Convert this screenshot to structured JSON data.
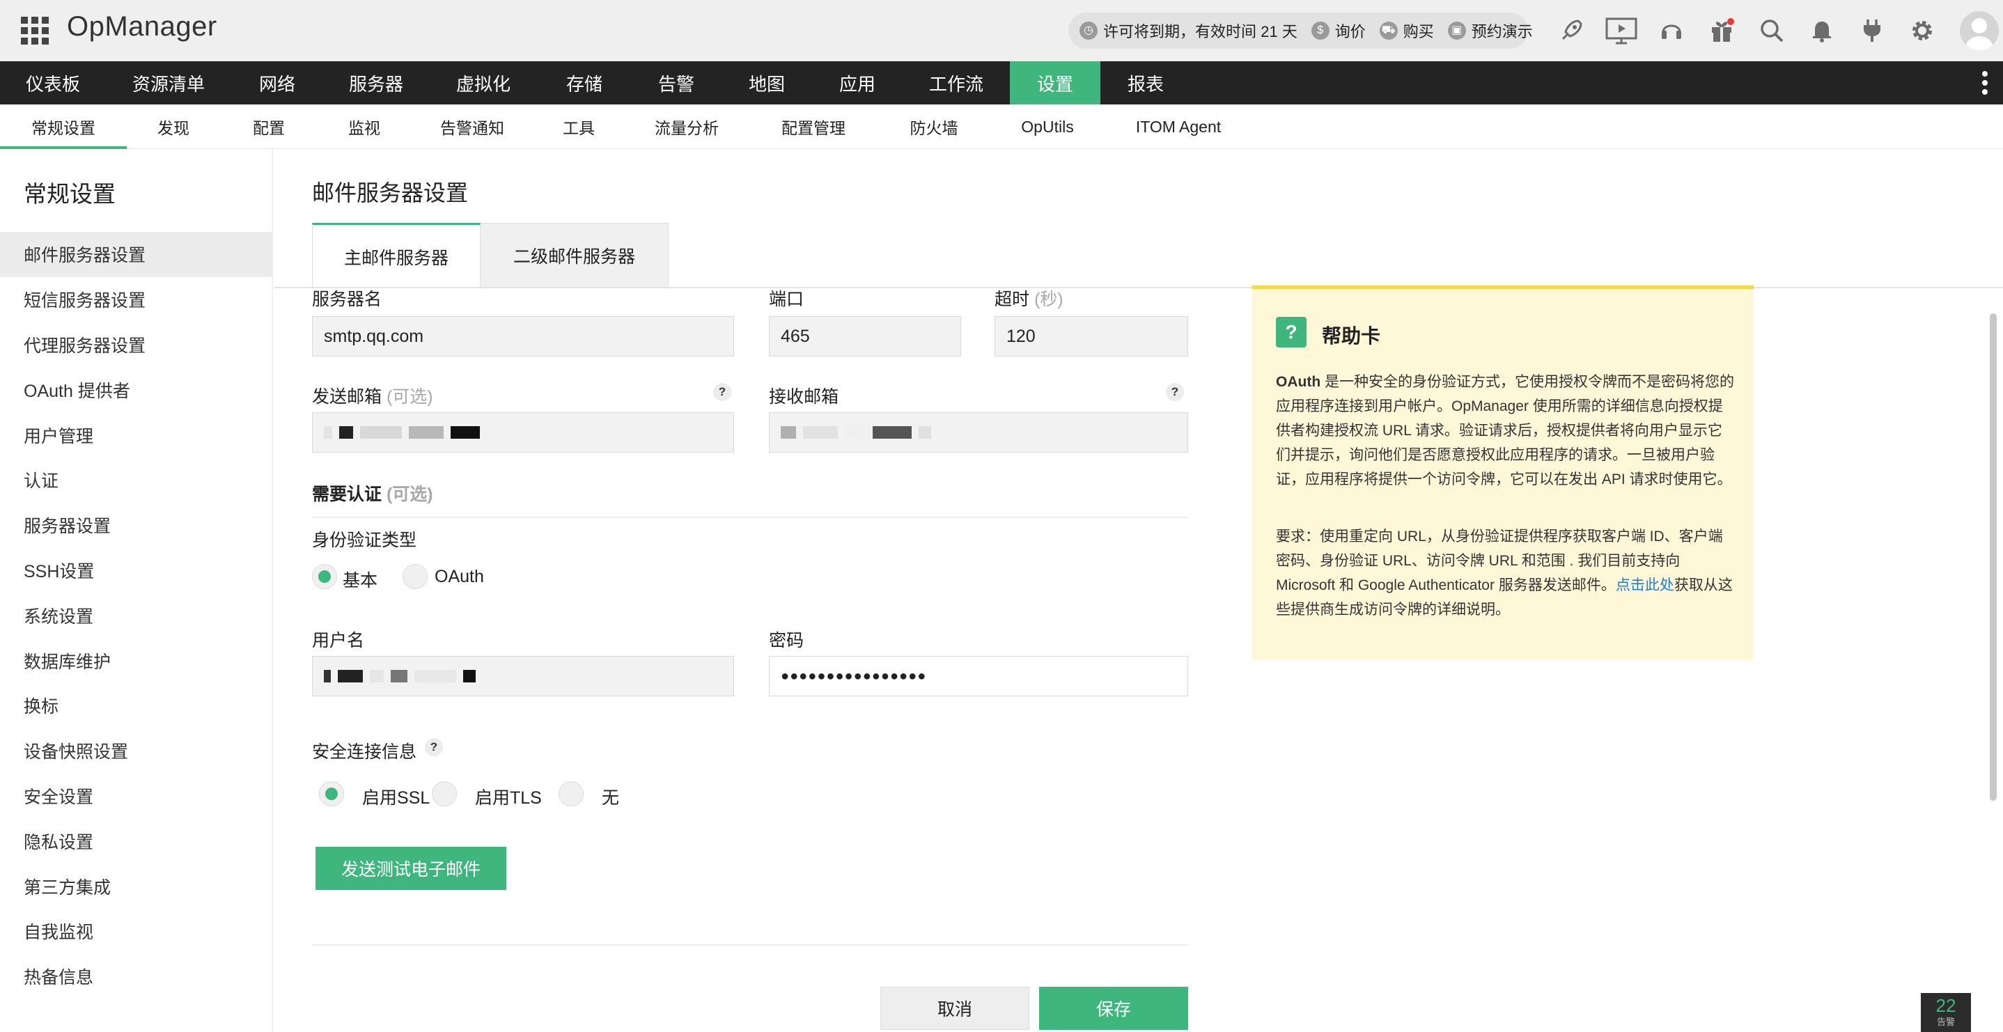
{
  "app": {
    "title": "OpManager"
  },
  "header": {
    "license_text": "许可将到期，有效时间 21 天",
    "quote_label": "询价",
    "buy_label": "购买",
    "demo_label": "预约演示",
    "icons": [
      "rocket-icon",
      "presentation-icon",
      "headset-icon",
      "gift-icon",
      "search-icon",
      "bell-icon",
      "plug-icon",
      "gear-icon",
      "user-avatar-icon"
    ]
  },
  "main_nav": {
    "items": [
      "仪表板",
      "资源清单",
      "网络",
      "服务器",
      "虚拟化",
      "存储",
      "告警",
      "地图",
      "应用",
      "工作流",
      "设置",
      "报表"
    ],
    "active_index": 10
  },
  "sub_nav": {
    "items": [
      "常规设置",
      "发现",
      "配置",
      "监视",
      "告警通知",
      "工具",
      "流量分析",
      "配置管理",
      "防火墙",
      "OpUtils",
      "ITOM Agent"
    ],
    "active_index": 0
  },
  "sidebar": {
    "title": "常规设置",
    "items": [
      "邮件服务器设置",
      "短信服务器设置",
      "代理服务器设置",
      "OAuth 提供者",
      "用户管理",
      "认证",
      "服务器设置",
      "SSH设置",
      "系统设置",
      "数据库维护",
      "换标",
      "设备快照设置",
      "安全设置",
      "隐私设置",
      "第三方集成",
      "自我监视",
      "热备信息"
    ],
    "active_index": 0
  },
  "page": {
    "title": "邮件服务器设置",
    "tabs": [
      "主邮件服务器",
      "二级邮件服务器"
    ],
    "active_tab": 0
  },
  "form": {
    "server_name_label": "服务器名",
    "server_name_value": "smtp.qq.com",
    "port_label": "端口",
    "port_value": "465",
    "timeout_label": "超时",
    "timeout_unit": "(秒)",
    "timeout_value": "120",
    "from_label": "发送邮箱",
    "from_optional": "(可选)",
    "to_label": "接收邮箱",
    "auth_label": "需要认证",
    "auth_optional": "(可选)",
    "auth_type_label": "身份验证类型",
    "auth_basic": "基本",
    "auth_oauth": "OAuth",
    "username_label": "用户名",
    "password_label": "密码",
    "password_value": "●●●●●●●●●●●●●●●●",
    "security_label": "安全连接信息",
    "ssl_label": "启用SSL",
    "tls_label": "启用TLS",
    "none_label": "无",
    "help_mark": "?",
    "test_button": "发送测试电子邮件",
    "cancel_button": "取消",
    "save_button": "保存"
  },
  "help_card": {
    "mark": "?",
    "title": "帮助卡",
    "p1_strong": "OAuth",
    "p1_rest": " 是一种安全的身份验证方式，它使用授权令牌而不是密码将您的应用程序连接到用户帐户。OpManager 使用所需的详细信息向授权提供者构建授权流 URL 请求。验证请求后，授权提供者将向用户显示它们并提示，询问他们是否愿意授权此应用程序的请求。一旦被用户验证，应用程序将提供一个访问令牌，它可以在发出 API 请求时使用它。",
    "p2_before": "要求：使用重定向 URL，从身份验证提供程序获取客户端 ID、客户端密码、身份验证 URL、访问令牌 URL 和范围 . 我们目前支持向 Microsoft 和 Google Authenticator 服务器发送邮件。",
    "p2_link": "点击此处",
    "p2_after": "获取从这些提供商生成访问令牌的详细说明。"
  },
  "alarm_badge": {
    "count": "22",
    "label": "告警"
  },
  "colors": {
    "accent": "#3fb67e",
    "nav_bg": "#232323",
    "help_bg": "#fff8d8",
    "help_border": "#f6d54b",
    "link": "#1c7ed6"
  }
}
